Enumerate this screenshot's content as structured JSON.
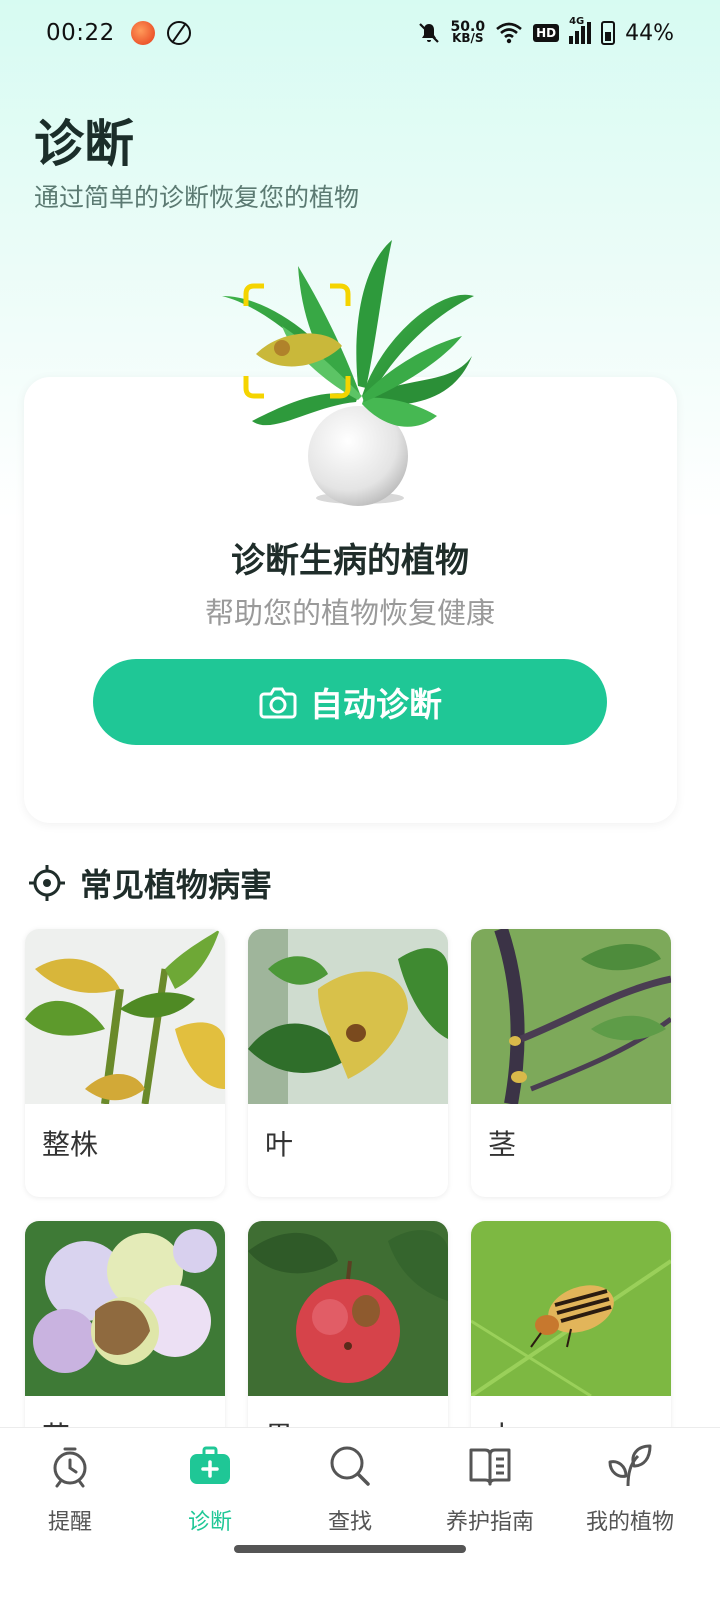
{
  "status_bar": {
    "time": "00:22",
    "speed_value": "50.0",
    "speed_unit": "KB/S",
    "hd": "HD",
    "network": "4G",
    "battery": "44%"
  },
  "header": {
    "title": "诊断",
    "subtitle": "通过简单的诊断恢复您的植物"
  },
  "hero": {
    "title": "诊断生病的植物",
    "subtitle": "帮助您的植物恢复健康",
    "button_label": "自动诊断"
  },
  "section": {
    "title": "常见植物病害"
  },
  "categories": [
    {
      "label": "整株"
    },
    {
      "label": "叶"
    },
    {
      "label": "茎"
    },
    {
      "label": "花"
    },
    {
      "label": "果"
    },
    {
      "label": "虫"
    }
  ],
  "nav": {
    "items": [
      {
        "label": "提醒",
        "icon": "alarm-clock-icon"
      },
      {
        "label": "诊断",
        "icon": "medical-kit-icon"
      },
      {
        "label": "查找",
        "icon": "search-icon"
      },
      {
        "label": "养护指南",
        "icon": "book-icon"
      },
      {
        "label": "我的植物",
        "icon": "plant-leaves-icon"
      }
    ],
    "active": "诊断"
  },
  "colors": {
    "accent": "#1fc796",
    "title": "#1b2e2a",
    "subtitle": "#5b7a72"
  }
}
